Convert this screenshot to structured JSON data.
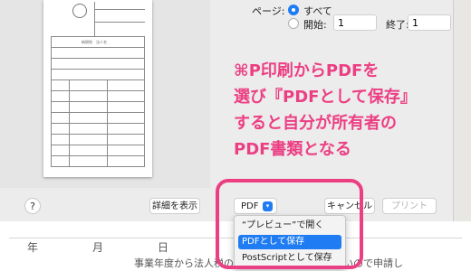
{
  "print_range": {
    "label": "ページ:",
    "option_all": "すべて",
    "option_from": "開始:",
    "from_value": "1",
    "to_label": "終了:",
    "to_value": "1"
  },
  "annotation": {
    "lines": [
      "⌘P印刷からPDFを",
      "選び『PDFとして保存』",
      "すると自分が所有者の",
      "PDF書類となる"
    ],
    "color": "#ec3f83"
  },
  "footer": {
    "help_label": "?",
    "details_label": "詳細を表示",
    "pdf_label": "PDF",
    "pdf_chevron": "chevron-down-icon",
    "cancel_label": "キャンセル",
    "print_label": "プリント"
  },
  "pdf_menu": {
    "items": [
      "“プレビュー”で開く",
      "PDFとして保存",
      "PostScriptとして保存"
    ],
    "selected_index": 1
  },
  "background_doc": {
    "date_line": "年　月　日",
    "body_text": "事業年度から法人税の　　　　　　っ提出したいので申請し"
  },
  "colors": {
    "accent": "#1f7cf2",
    "highlight": "#ec3f83"
  }
}
